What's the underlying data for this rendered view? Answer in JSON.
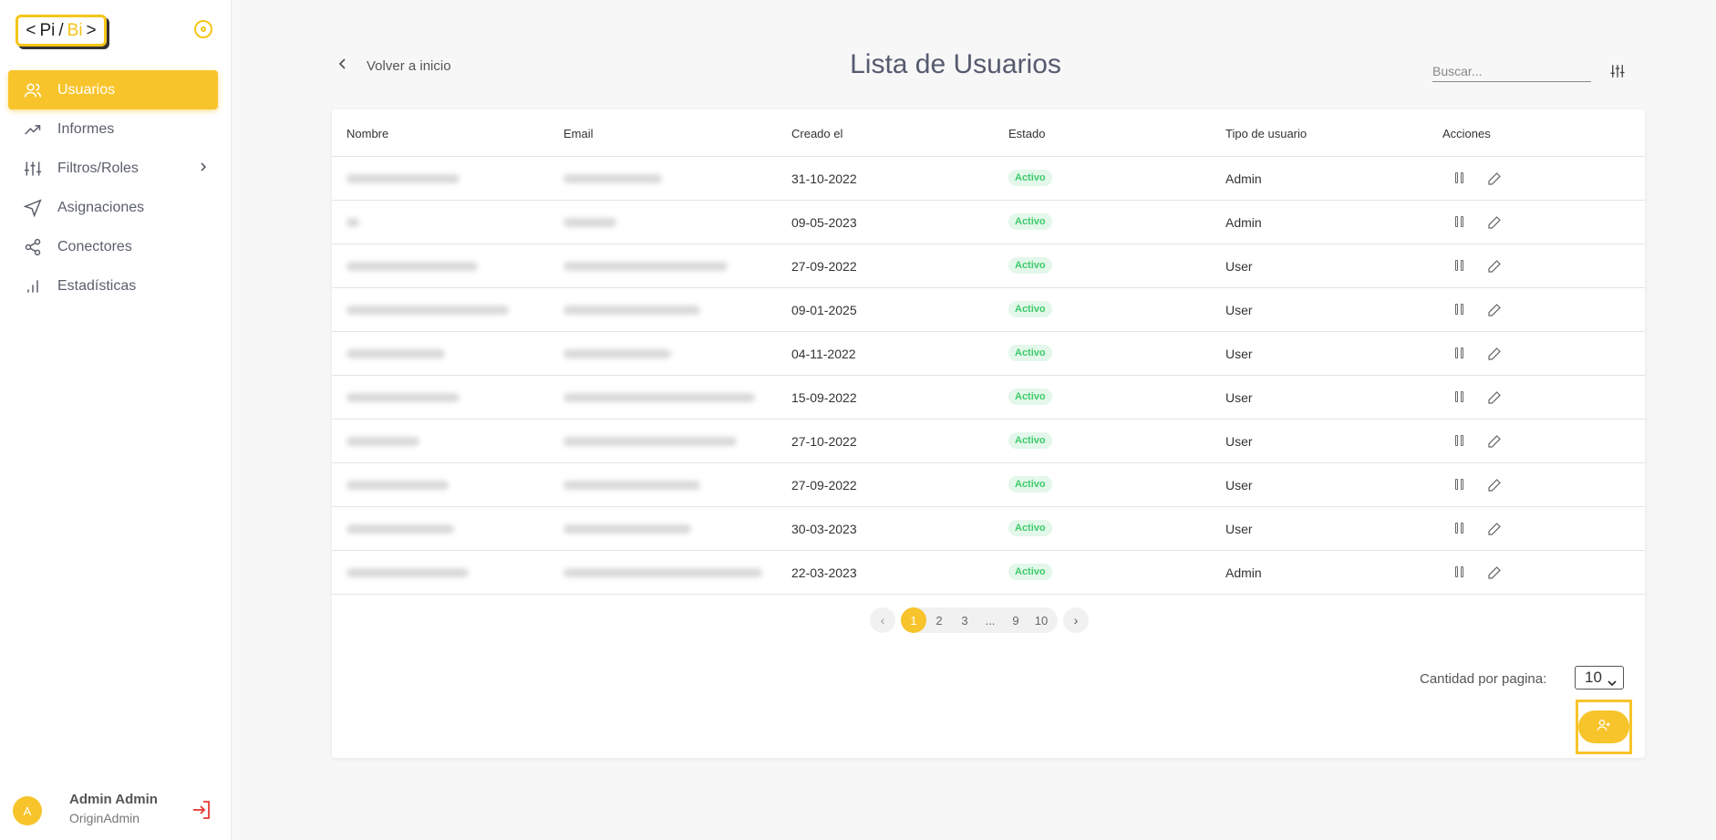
{
  "logo": {
    "left": "<",
    "pi": "Pi",
    "slash": "/",
    "bi": "Bi",
    "right": ">"
  },
  "sidebar": {
    "items": [
      {
        "label": "Usuarios",
        "icon": "users-icon",
        "active": true
      },
      {
        "label": "Informes",
        "icon": "trend-icon"
      },
      {
        "label": "Filtros/Roles",
        "icon": "sliders-icon",
        "has_submenu": true
      },
      {
        "label": "Asignaciones",
        "icon": "send-icon"
      },
      {
        "label": "Conectores",
        "icon": "share-icon"
      },
      {
        "label": "Estadísticas",
        "icon": "bar-chart-icon"
      }
    ],
    "user": {
      "initial": "A",
      "name": "Admin Admin",
      "role": "OriginAdmin"
    }
  },
  "header": {
    "back_label": "Volver a inicio",
    "title": "Lista de Usuarios",
    "search_placeholder": "Buscar..."
  },
  "table": {
    "columns": [
      "Nombre",
      "Email",
      "Creado el",
      "Estado",
      "Tipo de usuario",
      "Acciones"
    ],
    "rows": [
      {
        "created": "31-10-2022",
        "status": "Activo",
        "type": "Admin"
      },
      {
        "created": "09-05-2023",
        "status": "Activo",
        "type": "Admin"
      },
      {
        "created": "27-09-2022",
        "status": "Activo",
        "type": "User"
      },
      {
        "created": "09-01-2025",
        "status": "Activo",
        "type": "User"
      },
      {
        "created": "04-11-2022",
        "status": "Activo",
        "type": "User"
      },
      {
        "created": "15-09-2022",
        "status": "Activo",
        "type": "User"
      },
      {
        "created": "27-10-2022",
        "status": "Activo",
        "type": "User"
      },
      {
        "created": "27-09-2022",
        "status": "Activo",
        "type": "User"
      },
      {
        "created": "30-03-2023",
        "status": "Activo",
        "type": "User"
      },
      {
        "created": "22-03-2023",
        "status": "Activo",
        "type": "Admin"
      }
    ]
  },
  "pagination": {
    "prev": "‹",
    "next": "›",
    "pages": [
      "1",
      "2",
      "3",
      "...",
      "9",
      "10"
    ],
    "current": "1"
  },
  "per_page": {
    "label": "Cantidad por pagina:",
    "value": "10"
  },
  "colors": {
    "accent": "#f8c42b",
    "active_badge_bg": "#e3f7ea",
    "active_badge_text": "#3ecb6b",
    "logout": "#e53935"
  }
}
